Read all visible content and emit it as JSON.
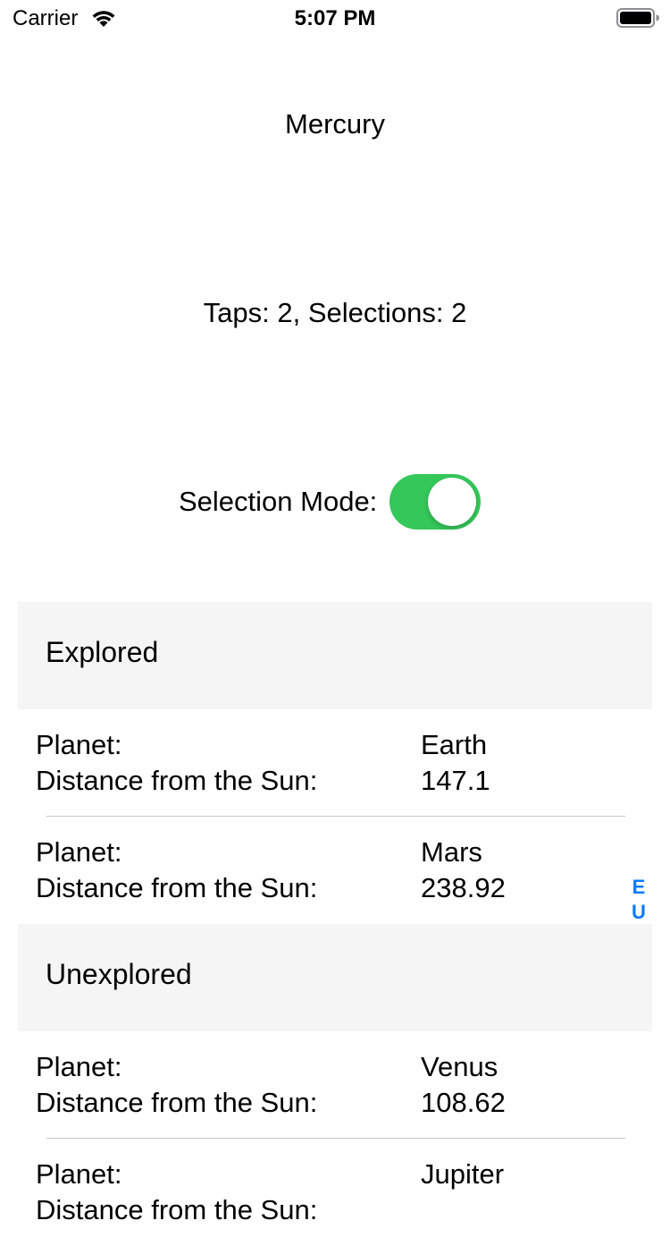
{
  "status_bar": {
    "carrier": "Carrier",
    "time": "5:07 PM",
    "wifi_icon": "wifi-icon",
    "battery_icon": "battery-icon"
  },
  "selected_planet": "Mercury",
  "counts": "Taps: 2, Selections: 2",
  "selection_mode": {
    "label": "Selection Mode:",
    "on": true,
    "accent_color": "#34c759"
  },
  "sections": [
    {
      "title": "Explored",
      "rows": [
        {
          "planet_label": "Planet:",
          "planet": "Earth",
          "distance_label": "Distance from the Sun:",
          "distance": "147.1"
        },
        {
          "planet_label": "Planet:",
          "planet": "Mars",
          "distance_label": "Distance from the Sun:",
          "distance": "238.92"
        }
      ]
    },
    {
      "title": "Unexplored",
      "rows": [
        {
          "planet_label": "Planet:",
          "planet": "Venus",
          "distance_label": "Distance from the Sun:",
          "distance": "108.62"
        },
        {
          "planet_label": "Planet:",
          "planet": "Jupiter",
          "distance_label": "Distance from the Sun:",
          "distance": ""
        }
      ]
    }
  ],
  "section_index": [
    "E",
    "U"
  ],
  "colors": {
    "index_tint": "#0a7aff",
    "header_background": "#f5f5f5"
  }
}
